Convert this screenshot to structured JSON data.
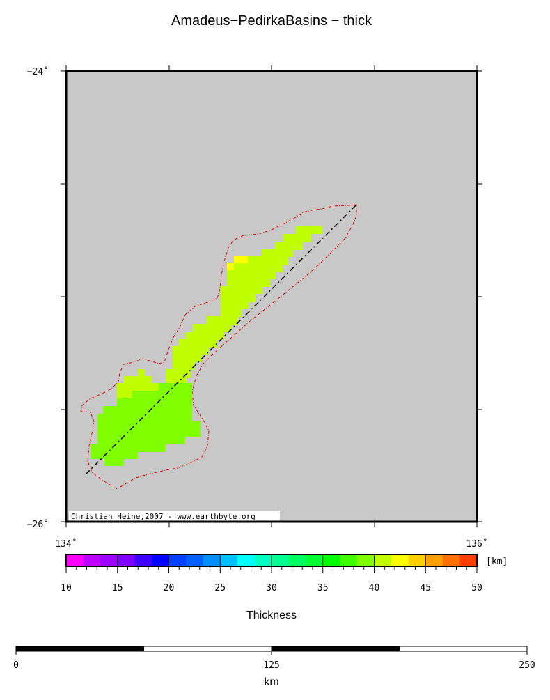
{
  "title": "Amadeus−PedirkaBasins − thick",
  "map": {
    "lat_labels": [
      "−24˚",
      "−26˚"
    ],
    "lon_labels": [
      "134˚",
      "136˚"
    ],
    "background_color": "#c8c8c8",
    "outline_color": "#e00000",
    "credit": "Christian Heine,2007 - www.earthbyte.org"
  },
  "colorbar": {
    "title": "Thickness",
    "unit": "[km]",
    "min": 10,
    "max": 50,
    "tick_labels": [
      "10",
      "15",
      "20",
      "25",
      "30",
      "35",
      "40",
      "45",
      "50"
    ],
    "colors": [
      "#ff00ff",
      "#c000ff",
      "#a000ff",
      "#7f00ff",
      "#4000ff",
      "#0000ff",
      "#0040ff",
      "#0060ff",
      "#0090ff",
      "#00c0ff",
      "#00ffff",
      "#00ffc0",
      "#00ff90",
      "#00ff60",
      "#00ff30",
      "#00ff00",
      "#40ff00",
      "#80ff00",
      "#c0ff00",
      "#ffff00",
      "#ffd000",
      "#ffa000",
      "#ff7000",
      "#ff4000"
    ]
  },
  "scalebar": {
    "unit": "km",
    "tick_labels": [
      "0",
      "125",
      "250"
    ]
  }
}
